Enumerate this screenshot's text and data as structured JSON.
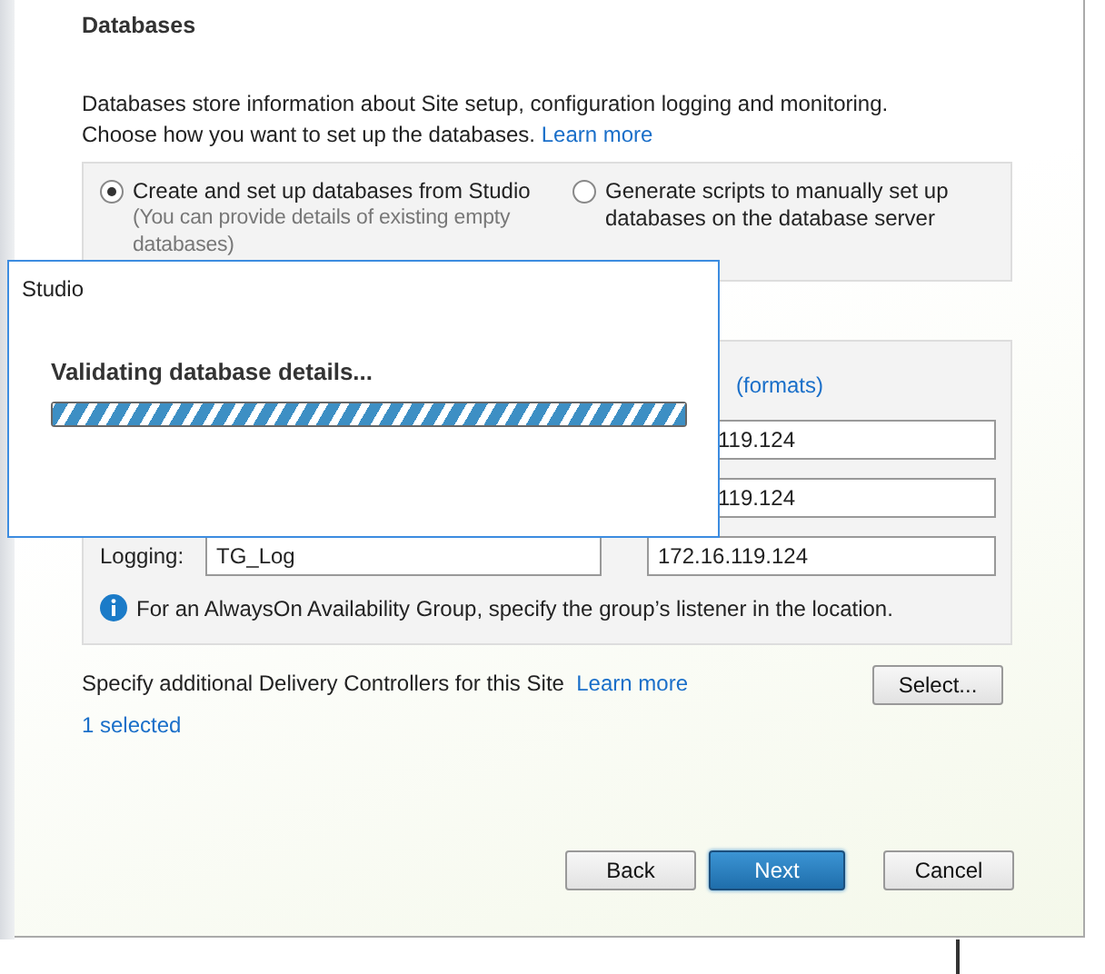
{
  "wizard": {
    "title": "Databases",
    "description": "Databases store information about Site setup, configuration logging and monitoring.",
    "description_2": "Choose how you want to set up the databases.",
    "description_link": "Learn more",
    "options": [
      {
        "label": "Create and set up databases from Studio",
        "note": "(You can provide details of existing empty databases)",
        "selected": true
      },
      {
        "label": "Generate scripts to manually set up databases on the database server",
        "selected": false
      }
    ],
    "location_link": "(formats)",
    "rows": [
      {
        "location": "119.124"
      },
      {
        "location": "119.124"
      },
      {
        "label": "Logging:",
        "name": "TG_Log",
        "location": "172.16.119.124"
      }
    ],
    "info": "For an AlwaysOn Availability Group, specify the group’s listener in the location.",
    "controllers_text": "Specify additional Delivery Controllers for this Site",
    "controllers_link": "Learn more",
    "select_button": "Select...",
    "selected_count": "1 selected",
    "buttons": [
      {
        "label": "Back",
        "primary": false
      },
      {
        "label": "Next",
        "primary": true
      },
      {
        "label": "Cancel",
        "primary": false
      }
    ]
  },
  "dialog": {
    "title": "Studio",
    "message": "Validating database details...",
    "progress": {
      "level": 1
    }
  }
}
